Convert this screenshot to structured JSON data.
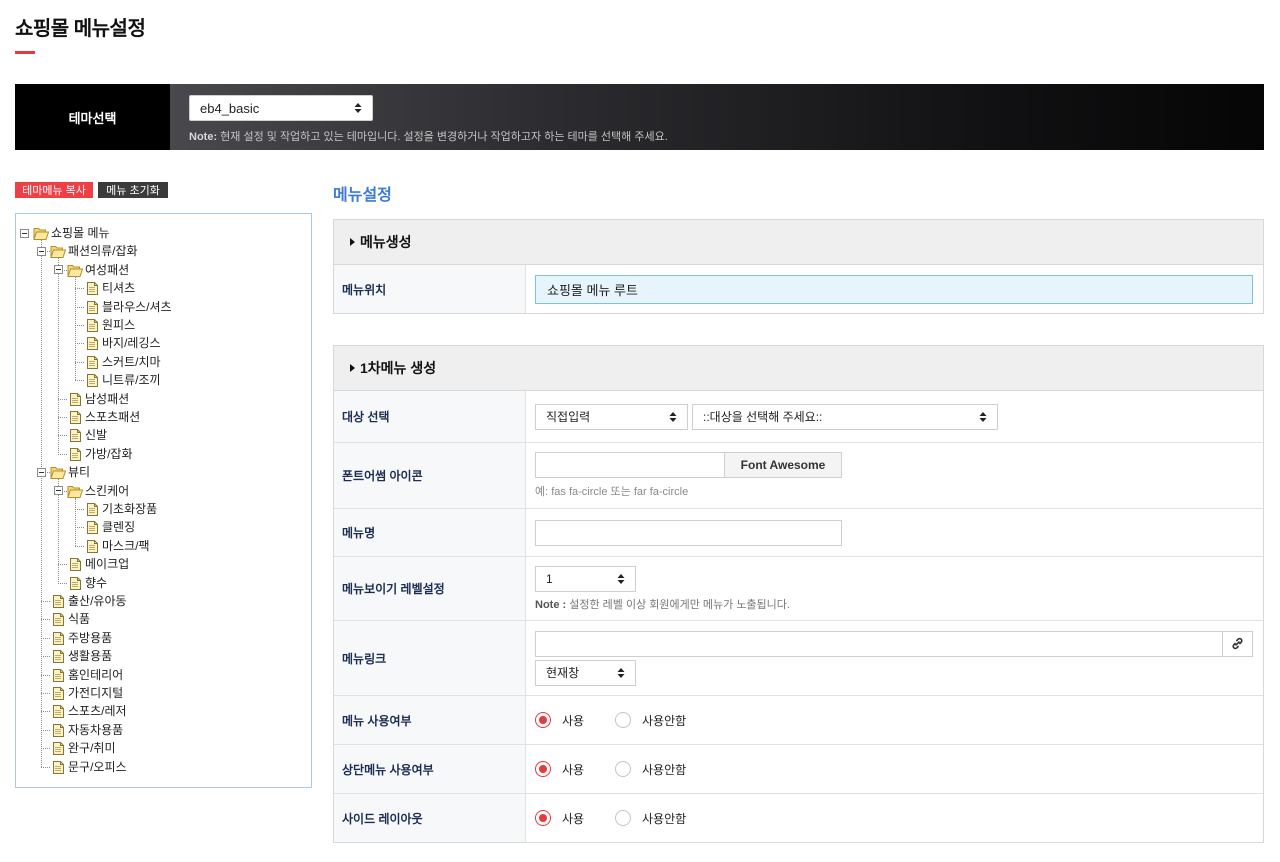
{
  "page": {
    "title": "쇼핑몰 메뉴설정"
  },
  "theme_bar": {
    "label": "테마선택",
    "select_value": "eb4_basic",
    "note_label": "Note:",
    "note_text": "현재 설정 및 작업하고 있는 테마입니다. 설정을 변경하거나 작업하고자 하는 테마를 선택해 주세요."
  },
  "tree_toolbar": {
    "copy_label": "테마메뉴 복사",
    "reset_label": "메뉴 초기화"
  },
  "tree": {
    "items": [
      {
        "label": "쇼핑몰 메뉴",
        "level": 0,
        "icon": "folder-open-icon",
        "expanded": true
      },
      {
        "label": "패션의류/잡화",
        "level": 1,
        "icon": "folder-open-icon",
        "expanded": true
      },
      {
        "label": "여성패션",
        "level": 2,
        "icon": "folder-open-icon",
        "expanded": true
      },
      {
        "label": "티셔츠",
        "level": 3,
        "icon": "file-icon"
      },
      {
        "label": "블라우스/셔츠",
        "level": 3,
        "icon": "file-icon"
      },
      {
        "label": "원피스",
        "level": 3,
        "icon": "file-icon"
      },
      {
        "label": "바지/레깅스",
        "level": 3,
        "icon": "file-icon"
      },
      {
        "label": "스커트/치마",
        "level": 3,
        "icon": "file-icon"
      },
      {
        "label": "니트류/조끼",
        "level": 3,
        "icon": "file-icon"
      },
      {
        "label": "남성패션",
        "level": 2,
        "icon": "file-icon"
      },
      {
        "label": "스포츠패션",
        "level": 2,
        "icon": "file-icon"
      },
      {
        "label": "신발",
        "level": 2,
        "icon": "file-icon"
      },
      {
        "label": "가방/잡화",
        "level": 2,
        "icon": "file-icon"
      },
      {
        "label": "뷰티",
        "level": 1,
        "icon": "folder-open-icon",
        "expanded": true
      },
      {
        "label": "스킨케어",
        "level": 2,
        "icon": "folder-open-icon",
        "expanded": true
      },
      {
        "label": "기초화장품",
        "level": 3,
        "icon": "file-icon"
      },
      {
        "label": "클렌징",
        "level": 3,
        "icon": "file-icon"
      },
      {
        "label": "마스크/팩",
        "level": 3,
        "icon": "file-icon"
      },
      {
        "label": "메이크업",
        "level": 2,
        "icon": "file-icon"
      },
      {
        "label": "향수",
        "level": 2,
        "icon": "file-icon"
      },
      {
        "label": "출산/유아동",
        "level": 1,
        "icon": "file-icon"
      },
      {
        "label": "식품",
        "level": 1,
        "icon": "file-icon"
      },
      {
        "label": "주방용품",
        "level": 1,
        "icon": "file-icon"
      },
      {
        "label": "생활용품",
        "level": 1,
        "icon": "file-icon"
      },
      {
        "label": "홈인테리어",
        "level": 1,
        "icon": "file-icon"
      },
      {
        "label": "가전디지털",
        "level": 1,
        "icon": "file-icon"
      },
      {
        "label": "스포츠/레저",
        "level": 1,
        "icon": "file-icon"
      },
      {
        "label": "자동차용품",
        "level": 1,
        "icon": "file-icon"
      },
      {
        "label": "완구/취미",
        "level": 1,
        "icon": "file-icon"
      },
      {
        "label": "문구/오피스",
        "level": 1,
        "icon": "file-icon"
      }
    ]
  },
  "settings": {
    "heading": "메뉴설정",
    "create_section": {
      "title": "메뉴생성",
      "location_label": "메뉴위치",
      "location_value": "쇼핑몰 메뉴 루트"
    },
    "first_menu": {
      "title": "1차메뉴 생성",
      "target": {
        "label": "대상 선택",
        "type_value": "직접입력",
        "target_value": "::대상을 선택해 주세요::"
      },
      "icon": {
        "label": "폰트어썸 아이콘",
        "button_label": "Font Awesome",
        "help": "예: fas fa-circle 또는 far fa-circle"
      },
      "name": {
        "label": "메뉴명"
      },
      "level": {
        "label": "메뉴보이기 레벨설정",
        "value": "1",
        "note_label": "Note :",
        "note_text": "설정한 레벨 이상 회원에게만 메뉴가 노출됩니다."
      },
      "link": {
        "label": "메뉴링크",
        "target_value": "현재창",
        "button_icon": "link-icon"
      },
      "use": {
        "label": "메뉴 사용여부",
        "options": [
          "사용",
          "사용안함"
        ],
        "selected_index": 0
      },
      "top_use": {
        "label": "상단메뉴 사용여부",
        "options": [
          "사용",
          "사용안함"
        ],
        "selected_index": 0
      },
      "side_layout": {
        "label": "사이드 레이아웃",
        "options": [
          "사용",
          "사용안함"
        ],
        "selected_index": 0
      }
    }
  },
  "colors": {
    "accent_red": "#e8383d",
    "heading_blue": "#3d7ad6",
    "label_navy": "#1b2e52",
    "reset_button": "#3b3b3b",
    "location_input_bg": "#e6f4fc"
  }
}
